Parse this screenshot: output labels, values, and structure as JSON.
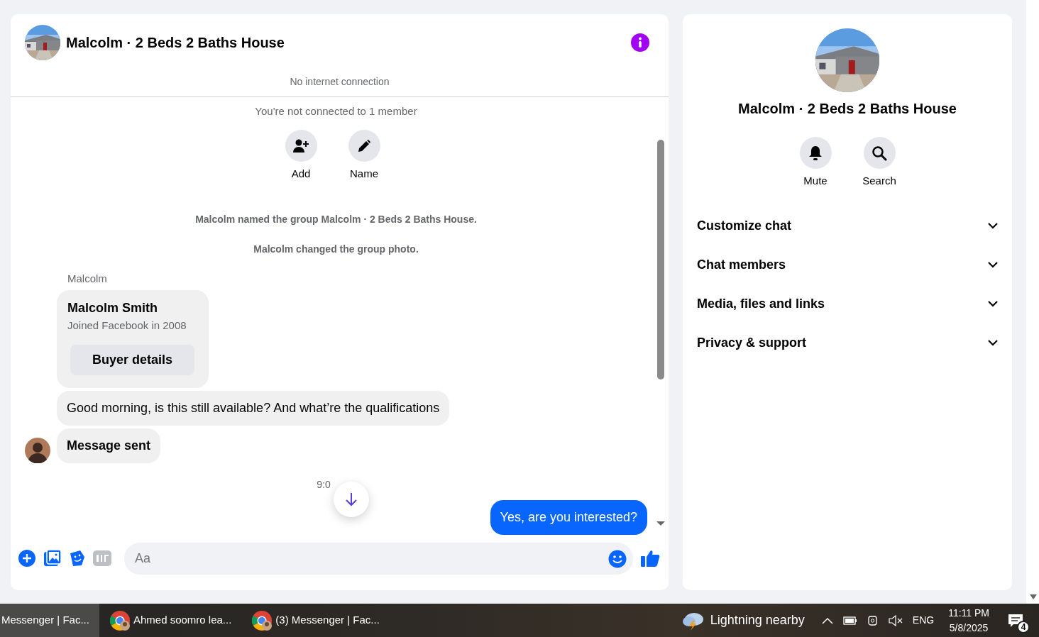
{
  "chat": {
    "title": "Malcolm · 2 Beds 2 Baths House",
    "banner": "No internet connection",
    "notice": "You're not connected to 1 member",
    "actions": [
      {
        "label": "Add",
        "kind": "add-person"
      },
      {
        "label": "Name",
        "kind": "edit"
      }
    ],
    "events": [
      "Malcolm named the group Malcolm · 2 Beds 2 Baths House.",
      "Malcolm changed the group photo."
    ],
    "sender": "Malcolm",
    "profile_card": {
      "name": "Malcolm Smith",
      "subtitle": "Joined Facebook in 2008",
      "button": "Buyer details"
    },
    "messages": [
      {
        "kind": "incoming",
        "text": "Good morning, is this still available? And what’re the qualifications",
        "bold": false
      },
      {
        "kind": "incoming",
        "text": "Message sent",
        "bold": true
      },
      {
        "kind": "timestamp",
        "text": "9:0"
      },
      {
        "kind": "outgoing",
        "text": "Yes, are you interested?"
      }
    ],
    "composer": {
      "placeholder": "Aa"
    }
  },
  "details": {
    "title": "Malcolm · 2 Beds 2 Baths House",
    "actions": [
      {
        "label": "Mute",
        "kind": "bell"
      },
      {
        "label": "Search",
        "kind": "search"
      }
    ],
    "sections": [
      {
        "label": "Customize chat",
        "expanded": false
      },
      {
        "label": "Chat members",
        "expanded": false
      },
      {
        "label": "Media, files and links",
        "expanded": false
      },
      {
        "label": "Privacy & support",
        "expanded": false
      }
    ]
  },
  "taskbar": {
    "apps": [
      {
        "label": "Messenger | Fac...",
        "kind": "plain",
        "selected": true
      },
      {
        "label": "Ahmed soomro lea...",
        "kind": "chrome",
        "selected": false
      },
      {
        "label": "(3) Messenger | Fac...",
        "kind": "chrome",
        "selected": false
      }
    ],
    "weather": "Lightning nearby",
    "language": "ENG",
    "time": "11:11 PM",
    "date": "5/8/2025",
    "notifications": "4"
  }
}
